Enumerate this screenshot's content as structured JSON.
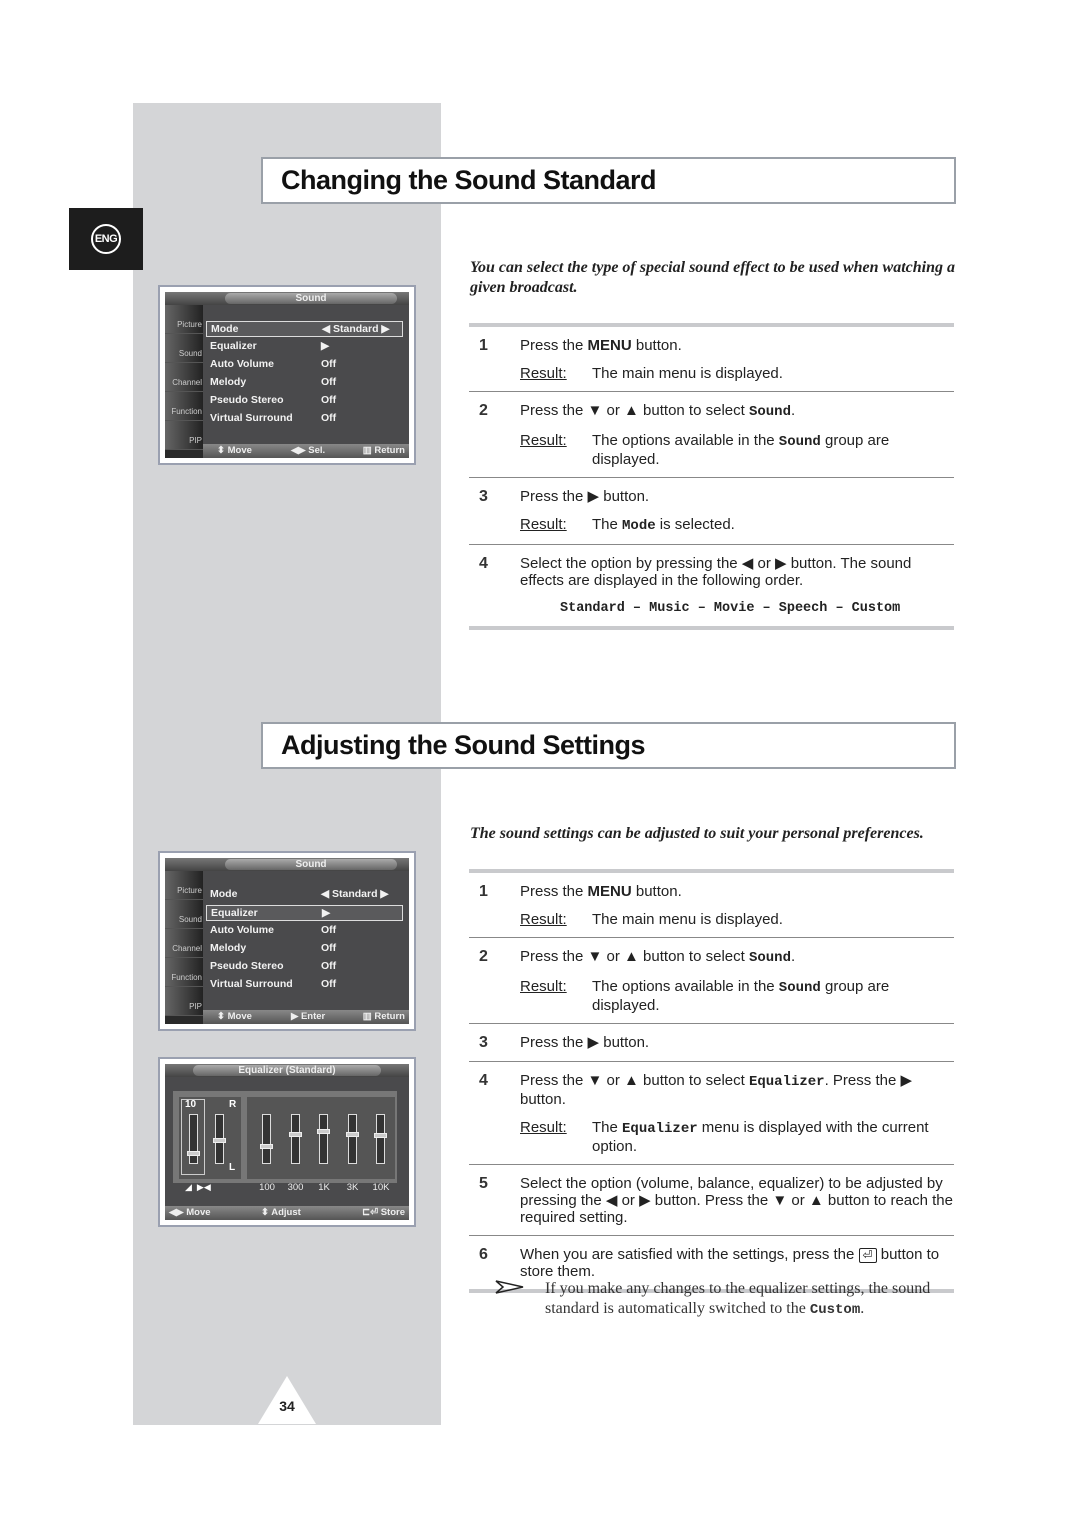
{
  "lang_badge": "ENG",
  "page_number": "34",
  "sections": [
    {
      "title": "Changing the Sound Standard",
      "intro": "You can select the type of special sound effect to be used when watching a given broadcast.",
      "steps": [
        {
          "n": "1",
          "lines": [
            [
              {
                "t": "Press the "
              },
              {
                "t": "MENU",
                "s": "b"
              },
              {
                "t": " button."
              }
            ]
          ],
          "result": [
            {
              "t": "The main menu is displayed."
            }
          ]
        },
        {
          "n": "2",
          "lines": [
            [
              {
                "t": "Press the ▼ or ▲ button to select  "
              },
              {
                "t": "Sound",
                "s": "m"
              },
              {
                "t": "."
              }
            ]
          ],
          "result": [
            {
              "t": "The options available in the "
            },
            {
              "t": "Sound",
              "s": "m"
            },
            {
              "t": " group are displayed."
            }
          ]
        },
        {
          "n": "3",
          "lines": [
            [
              {
                "t": "Press the ▶ button."
              }
            ]
          ],
          "result": [
            {
              "t": "The  "
            },
            {
              "t": "Mode",
              "s": "m"
            },
            {
              "t": " is selected."
            }
          ]
        },
        {
          "n": "4",
          "lines": [
            [
              {
                "t": "Select the option by pressing the ◀ or ▶ button. The sound effects are displayed in the following order."
              }
            ]
          ],
          "order": "Standard – Music – Movie – Speech – Custom"
        }
      ]
    },
    {
      "title": "Adjusting the Sound Settings",
      "intro": "The sound settings can be adjusted to suit your personal preferences.",
      "steps": [
        {
          "n": "1",
          "lines": [
            [
              {
                "t": "Press the "
              },
              {
                "t": "MENU",
                "s": "b"
              },
              {
                "t": " button."
              }
            ]
          ],
          "result": [
            {
              "t": "The main menu is displayed."
            }
          ]
        },
        {
          "n": "2",
          "lines": [
            [
              {
                "t": "Press the ▼ or ▲ button to select  "
              },
              {
                "t": "Sound",
                "s": "m"
              },
              {
                "t": "."
              }
            ]
          ],
          "result": [
            {
              "t": "The options available in the "
            },
            {
              "t": "Sound",
              "s": "m"
            },
            {
              "t": " group are displayed."
            }
          ]
        },
        {
          "n": "3",
          "lines": [
            [
              {
                "t": "Press the ▶ button."
              }
            ]
          ]
        },
        {
          "n": "4",
          "lines": [
            [
              {
                "t": "Press the ▼ or ▲ button to select "
              },
              {
                "t": "Equalizer",
                "s": "m"
              },
              {
                "t": ". Press the ▶ button."
              }
            ]
          ],
          "result": [
            {
              "t": "The "
            },
            {
              "t": "Equalizer",
              "s": "m"
            },
            {
              "t": " menu is displayed with the current option."
            }
          ]
        },
        {
          "n": "5",
          "lines": [
            [
              {
                "t": "Select the option (volume, balance, equalizer) to be adjusted by pressing the ◀ or ▶ button. Press the ▼ or ▲ button to reach the required setting."
              }
            ]
          ]
        },
        {
          "n": "6",
          "lines": [
            [
              {
                "t": "When you are satisfied with the settings, press the  "
              },
              {
                "t": "⏎",
                "s": "icon"
              },
              {
                "t": "  button to store them."
              }
            ]
          ]
        }
      ]
    }
  ],
  "result_label": "Result:",
  "tip": {
    "icon": "arrow-pointer-icon",
    "before": "If you make any changes to the equalizer settings, the sound standard is automatically switched to the ",
    "bold": "Custom",
    "after": "."
  },
  "osd_sound_1": {
    "title": "Sound",
    "tabs": [
      "Picture",
      "Sound",
      "Channel",
      "Function",
      "PIP"
    ],
    "rows": [
      {
        "l": "Mode",
        "v": "◀  Standard  ▶"
      },
      {
        "l": "Equalizer",
        "v": "▶"
      },
      {
        "l": "Auto Volume",
        "v": "Off"
      },
      {
        "l": "Melody",
        "v": "Off"
      },
      {
        "l": "Pseudo Stereo",
        "v": "Off"
      },
      {
        "l": "Virtual Surround",
        "v": "Off"
      }
    ],
    "selected": 0,
    "footer": [
      "⬍ Move",
      "◀▶ Sel.",
      "Return"
    ]
  },
  "osd_sound_2": {
    "title": "Sound",
    "tabs": [
      "Picture",
      "Sound",
      "Channel",
      "Function",
      "PIP"
    ],
    "rows": [
      {
        "l": "Mode",
        "v": "◀  Standard  ▶"
      },
      {
        "l": "Equalizer",
        "v": "▶"
      },
      {
        "l": "Auto Volume",
        "v": "Off"
      },
      {
        "l": "Melody",
        "v": "Off"
      },
      {
        "l": "Pseudo Stereo",
        "v": "Off"
      },
      {
        "l": "Virtual Surround",
        "v": "Off"
      }
    ],
    "selected": 1,
    "footer": [
      "⬍ Move",
      "▶ Enter",
      "Return"
    ]
  },
  "osd_eq": {
    "title": "Equalizer (Standard)",
    "volume": "10",
    "balance_top": "R",
    "balance_bottom": "L",
    "bands": [
      "100",
      "300",
      "1K",
      "3K",
      "10K"
    ],
    "band_levels": [
      0.35,
      0.62,
      0.68,
      0.62,
      0.6
    ],
    "volume_level": 0.2,
    "balance_level": 0.5,
    "footer": [
      "◀▶ Move",
      "⬍ Adjust",
      "Store"
    ]
  }
}
